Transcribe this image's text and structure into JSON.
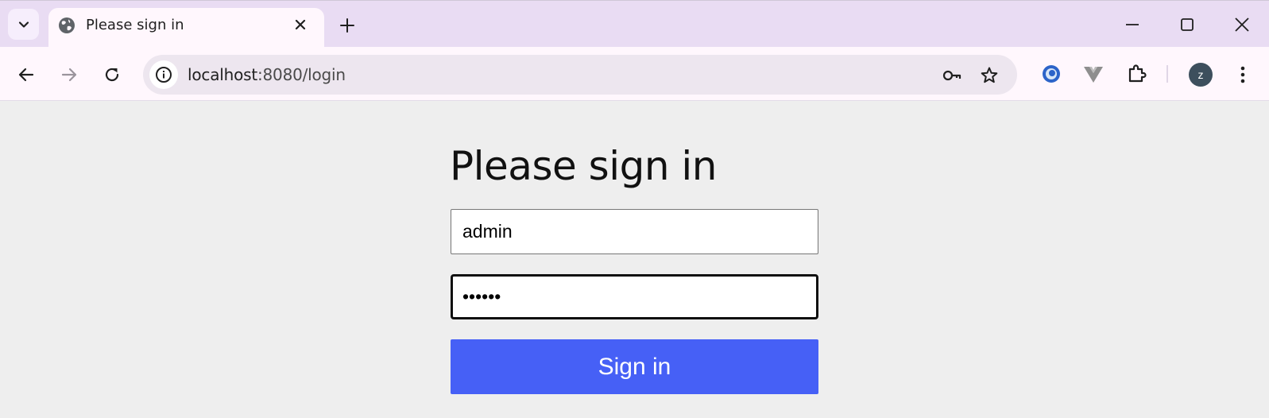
{
  "browser": {
    "tab_title": "Please sign in",
    "url_host": "localhost",
    "url_path": ":8080/login",
    "avatar_letter": "z"
  },
  "form": {
    "heading": "Please sign in",
    "username_value": "admin",
    "password_value": "••••••",
    "submit_label": "Sign in"
  },
  "colors": {
    "primary_button": "#4660f6",
    "page_background": "#eeeeee",
    "titlebar": "#e9dcf3"
  }
}
